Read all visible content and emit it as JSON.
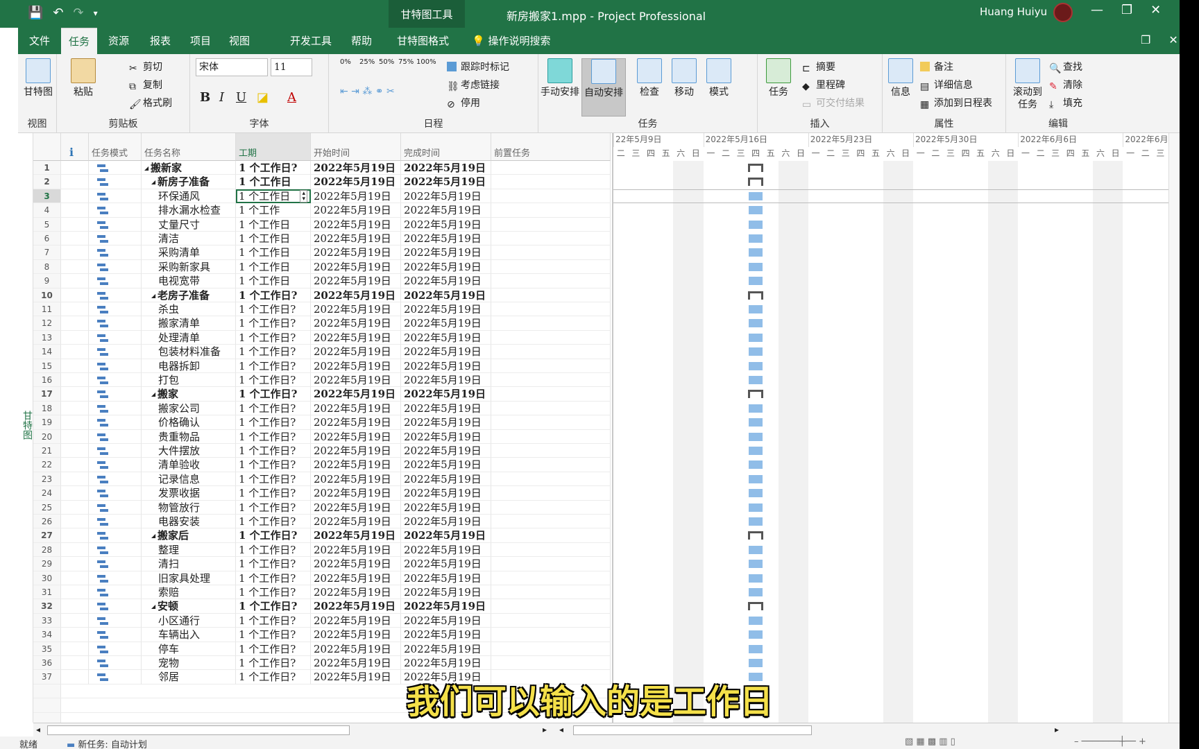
{
  "titlebar": {
    "context_tab": "甘特图工具",
    "doc_title": "新房搬家1.mpp  -  Project Professional",
    "user": "Huang Huiyu"
  },
  "tabs": [
    "文件",
    "任务",
    "资源",
    "报表",
    "项目",
    "视图",
    "开发工具",
    "帮助",
    "甘特图格式"
  ],
  "search_label": "操作说明搜索",
  "ribbon": {
    "view_group": {
      "label": "视图",
      "gantt_btn": "甘特图"
    },
    "clipboard": {
      "label": "剪贴板",
      "paste": "粘贴",
      "cut": "剪切",
      "copy": "复制",
      "format_painter": "格式刷"
    },
    "font": {
      "label": "字体",
      "name": "宋体",
      "size": "11",
      "b": "B",
      "i": "I",
      "u": "U",
      "a": "A"
    },
    "schedule": {
      "label": "日程",
      "track": "跟踪时标记",
      "respect": "考虑链接",
      "inactivate": "停用",
      "pcts": [
        "0%",
        "25%",
        "50%",
        "75%",
        "100%"
      ]
    },
    "tasks": {
      "label": "任务",
      "manual": "手动安排",
      "auto": "自动安排",
      "inspect": "检查",
      "move": "移动",
      "mode": "模式"
    },
    "insert": {
      "label": "插入",
      "task": "任务",
      "summary": "摘要",
      "milestone": "里程碑",
      "deliverable": "可交付结果"
    },
    "properties": {
      "label": "属性",
      "info": "信息",
      "notes": "备注",
      "details": "详细信息",
      "timeline": "添加到日程表"
    },
    "editing": {
      "label": "编辑",
      "scroll": "滚动到任务",
      "find": "查找",
      "clear": "清除",
      "fill": "填充"
    }
  },
  "columns": {
    "info": "ℹ",
    "mode": "任务模式",
    "name": "任务名称",
    "duration": "工期",
    "start": "开始时间",
    "finish": "完成时间",
    "pred": "前置任务"
  },
  "sidebar_label": "甘特图",
  "rows": [
    {
      "id": "1",
      "name": "搬新家",
      "level": 0,
      "summary": true,
      "dur": "1 个工作日?",
      "start": "2022年5月19日",
      "finish": "2022年5月19日"
    },
    {
      "id": "2",
      "name": "新房子准备",
      "level": 1,
      "summary": true,
      "dur": "1 个工作日",
      "start": "2022年5月19日",
      "finish": "2022年5月19日"
    },
    {
      "id": "3",
      "name": "环保通风",
      "level": 2,
      "summary": false,
      "dur": "1 个工作日",
      "start": "2022年5月19日",
      "finish": "2022年5月19日"
    },
    {
      "id": "4",
      "name": "排水漏水检查",
      "level": 2,
      "summary": false,
      "dur": "1 个工作",
      "start": "2022年5月19日",
      "finish": "2022年5月19日"
    },
    {
      "id": "5",
      "name": "丈量尺寸",
      "level": 2,
      "summary": false,
      "dur": "1 个工作日",
      "start": "2022年5月19日",
      "finish": "2022年5月19日"
    },
    {
      "id": "6",
      "name": "清洁",
      "level": 2,
      "summary": false,
      "dur": "1 个工作日",
      "start": "2022年5月19日",
      "finish": "2022年5月19日"
    },
    {
      "id": "7",
      "name": "采购清单",
      "level": 2,
      "summary": false,
      "dur": "1 个工作日",
      "start": "2022年5月19日",
      "finish": "2022年5月19日"
    },
    {
      "id": "8",
      "name": "采购新家具",
      "level": 2,
      "summary": false,
      "dur": "1 个工作日",
      "start": "2022年5月19日",
      "finish": "2022年5月19日"
    },
    {
      "id": "9",
      "name": "电视宽带",
      "level": 2,
      "summary": false,
      "dur": "1 个工作日",
      "start": "2022年5月19日",
      "finish": "2022年5月19日"
    },
    {
      "id": "10",
      "name": "老房子准备",
      "level": 1,
      "summary": true,
      "dur": "1 个工作日?",
      "start": "2022年5月19日",
      "finish": "2022年5月19日"
    },
    {
      "id": "11",
      "name": "杀虫",
      "level": 2,
      "summary": false,
      "dur": "1 个工作日?",
      "start": "2022年5月19日",
      "finish": "2022年5月19日"
    },
    {
      "id": "12",
      "name": "搬家清单",
      "level": 2,
      "summary": false,
      "dur": "1 个工作日?",
      "start": "2022年5月19日",
      "finish": "2022年5月19日"
    },
    {
      "id": "13",
      "name": "处理清单",
      "level": 2,
      "summary": false,
      "dur": "1 个工作日?",
      "start": "2022年5月19日",
      "finish": "2022年5月19日"
    },
    {
      "id": "14",
      "name": "包装材料准备",
      "level": 2,
      "summary": false,
      "dur": "1 个工作日?",
      "start": "2022年5月19日",
      "finish": "2022年5月19日"
    },
    {
      "id": "15",
      "name": "电器拆卸",
      "level": 2,
      "summary": false,
      "dur": "1 个工作日?",
      "start": "2022年5月19日",
      "finish": "2022年5月19日"
    },
    {
      "id": "16",
      "name": "打包",
      "level": 2,
      "summary": false,
      "dur": "1 个工作日?",
      "start": "2022年5月19日",
      "finish": "2022年5月19日"
    },
    {
      "id": "17",
      "name": "搬家",
      "level": 1,
      "summary": true,
      "dur": "1 个工作日?",
      "start": "2022年5月19日",
      "finish": "2022年5月19日"
    },
    {
      "id": "18",
      "name": "搬家公司",
      "level": 2,
      "summary": false,
      "dur": "1 个工作日?",
      "start": "2022年5月19日",
      "finish": "2022年5月19日"
    },
    {
      "id": "19",
      "name": "价格确认",
      "level": 2,
      "summary": false,
      "dur": "1 个工作日?",
      "start": "2022年5月19日",
      "finish": "2022年5月19日"
    },
    {
      "id": "20",
      "name": "贵重物品",
      "level": 2,
      "summary": false,
      "dur": "1 个工作日?",
      "start": "2022年5月19日",
      "finish": "2022年5月19日"
    },
    {
      "id": "21",
      "name": "大件摆放",
      "level": 2,
      "summary": false,
      "dur": "1 个工作日?",
      "start": "2022年5月19日",
      "finish": "2022年5月19日"
    },
    {
      "id": "22",
      "name": "清单验收",
      "level": 2,
      "summary": false,
      "dur": "1 个工作日?",
      "start": "2022年5月19日",
      "finish": "2022年5月19日"
    },
    {
      "id": "23",
      "name": "记录信息",
      "level": 2,
      "summary": false,
      "dur": "1 个工作日?",
      "start": "2022年5月19日",
      "finish": "2022年5月19日"
    },
    {
      "id": "24",
      "name": "发票收据",
      "level": 2,
      "summary": false,
      "dur": "1 个工作日?",
      "start": "2022年5月19日",
      "finish": "2022年5月19日"
    },
    {
      "id": "25",
      "name": "物管放行",
      "level": 2,
      "summary": false,
      "dur": "1 个工作日?",
      "start": "2022年5月19日",
      "finish": "2022年5月19日"
    },
    {
      "id": "26",
      "name": "电器安装",
      "level": 2,
      "summary": false,
      "dur": "1 个工作日?",
      "start": "2022年5月19日",
      "finish": "2022年5月19日"
    },
    {
      "id": "27",
      "name": "搬家后",
      "level": 1,
      "summary": true,
      "dur": "1 个工作日?",
      "start": "2022年5月19日",
      "finish": "2022年5月19日"
    },
    {
      "id": "28",
      "name": "整理",
      "level": 2,
      "summary": false,
      "dur": "1 个工作日?",
      "start": "2022年5月19日",
      "finish": "2022年5月19日"
    },
    {
      "id": "29",
      "name": "清扫",
      "level": 2,
      "summary": false,
      "dur": "1 个工作日?",
      "start": "2022年5月19日",
      "finish": "2022年5月19日"
    },
    {
      "id": "30",
      "name": "旧家具处理",
      "level": 2,
      "summary": false,
      "dur": "1 个工作日?",
      "start": "2022年5月19日",
      "finish": "2022年5月19日"
    },
    {
      "id": "31",
      "name": "索赔",
      "level": 2,
      "summary": false,
      "dur": "1 个工作日?",
      "start": "2022年5月19日",
      "finish": "2022年5月19日"
    },
    {
      "id": "32",
      "name": "安顿",
      "level": 1,
      "summary": true,
      "dur": "1 个工作日?",
      "start": "2022年5月19日",
      "finish": "2022年5月19日"
    },
    {
      "id": "33",
      "name": "小区通行",
      "level": 2,
      "summary": false,
      "dur": "1 个工作日?",
      "start": "2022年5月19日",
      "finish": "2022年5月19日"
    },
    {
      "id": "34",
      "name": "车辆出入",
      "level": 2,
      "summary": false,
      "dur": "1 个工作日?",
      "start": "2022年5月19日",
      "finish": "2022年5月19日"
    },
    {
      "id": "35",
      "name": "停车",
      "level": 2,
      "summary": false,
      "dur": "1 个工作日?",
      "start": "2022年5月19日",
      "finish": "2022年5月19日"
    },
    {
      "id": "36",
      "name": "宠物",
      "level": 2,
      "summary": false,
      "dur": "1 个工作日?",
      "start": "2022年5月19日",
      "finish": "2022年5月19日"
    },
    {
      "id": "37",
      "name": "邻居",
      "level": 2,
      "summary": false,
      "dur": "1 个工作日?",
      "start": "2022年5月19日",
      "finish": "2022年5月19日"
    }
  ],
  "gantt": {
    "weeks": [
      "22年5月9日",
      "2022年5月16日",
      "2022年5月23日",
      "2022年5月30日",
      "2022年6月6日",
      "2022年6月"
    ],
    "days": [
      "一",
      "二",
      "三",
      "四",
      "五",
      "六",
      "日"
    ],
    "task_day": "四"
  },
  "status": {
    "ready": "就绪",
    "new_task": "新任务: 自动计划"
  },
  "subtitle": "我们可以输入的是工作日"
}
